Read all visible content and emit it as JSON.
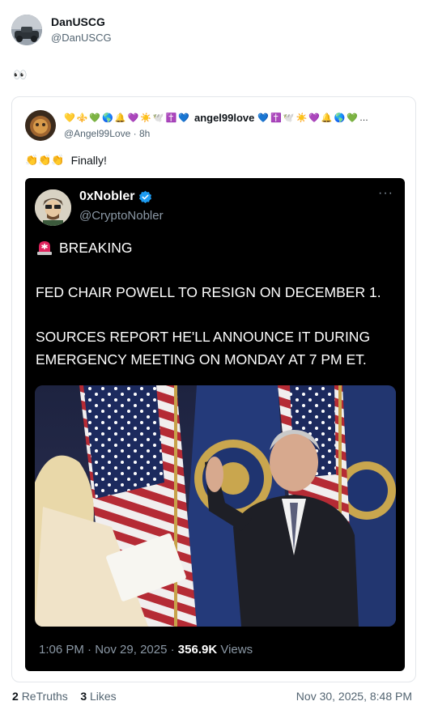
{
  "post": {
    "author_name": "DanUSCG",
    "author_handle": "@DanUSCG",
    "body": "👀"
  },
  "quote": {
    "emojis_before": "💛⚜️💚🌎🔔💜☀️🕊️✝️💙",
    "name": "angel99love",
    "emojis_after": "💙✝️🕊️☀️💜🔔🌎💚…",
    "handle": "@Angel99Love",
    "time": "8h",
    "text": "Finally!",
    "claps": "👏👏👏"
  },
  "screenshot": {
    "name": "0xNobler",
    "handle": "@CryptoNobler",
    "more": "···",
    "line1": "BREAKING",
    "line2": "FED CHAIR POWELL TO RESIGN ON DECEMBER 1.",
    "line3": "SOURCES REPORT HE'LL ANNOUNCE IT DURING",
    "line4": "EMERGENCY MEETING ON MONDAY AT 7 PM ET.",
    "time": "1:06 PM",
    "date": "Nov 29, 2025",
    "views_count": "356.9K",
    "views_label": "Views"
  },
  "footer": {
    "retruths_count": "2",
    "retruths_label": "ReTruths",
    "likes_count": "3",
    "likes_label": "Likes",
    "timestamp": "Nov 30, 2025, 8:48 PM"
  }
}
